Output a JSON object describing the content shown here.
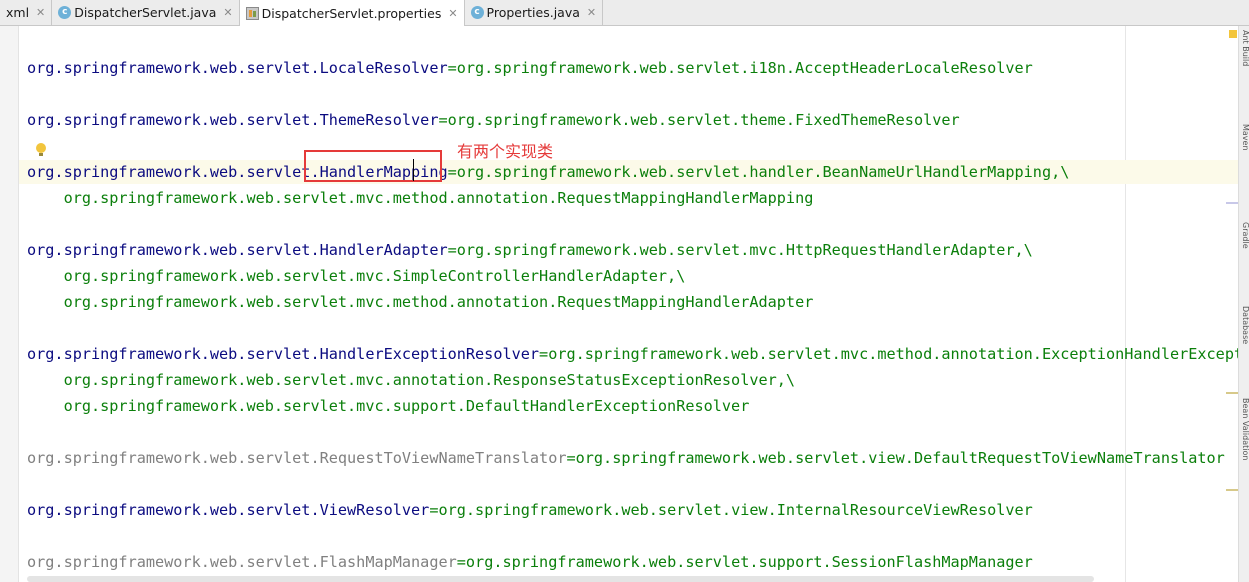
{
  "tabs": [
    {
      "label": "xml",
      "icon": "none"
    },
    {
      "label": "DispatcherServlet.java",
      "icon": "java-class-icon"
    },
    {
      "label": "DispatcherServlet.properties",
      "icon": "properties-file-icon",
      "active": true
    },
    {
      "label": "Properties.java",
      "icon": "java-class-icon"
    }
  ],
  "annotation": "有两个实现类",
  "sidebar_labels": [
    "Ant Build",
    "Maven",
    "Gradle",
    "Database",
    "Bean Validation"
  ],
  "colors": {
    "key": "#0b0b80",
    "value": "#0b7f0b",
    "annotation": "#e53a3a",
    "dim": "#808080"
  },
  "lines": {
    "l1_key": "org.springframework.web.servlet.LocaleResolver",
    "l1_val": "=org.springframework.web.servlet.i18n.AcceptHeaderLocaleResolver",
    "l2_key": "org.springframework.web.servlet.ThemeResolver",
    "l2_val": "=org.springframework.web.servlet.theme.FixedThemeResolver",
    "l3_key": "org.springframework.web.servlet.HandlerMapping",
    "l3_val": "=org.springframework.web.servlet.handler.BeanNameUrlHandlerMapping,\\",
    "l4_val": "    org.springframework.web.servlet.mvc.method.annotation.RequestMappingHandlerMapping",
    "l5_key": "org.springframework.web.servlet.HandlerAdapter",
    "l5_val": "=org.springframework.web.servlet.mvc.HttpRequestHandlerAdapter,\\",
    "l6_val": "    org.springframework.web.servlet.mvc.SimpleControllerHandlerAdapter,\\",
    "l7_val": "    org.springframework.web.servlet.mvc.method.annotation.RequestMappingHandlerAdapter",
    "l8_key": "org.springframework.web.servlet.HandlerExceptionResolver",
    "l8_val": "=org.springframework.web.servlet.mvc.method.annotation.ExceptionHandlerExceptio",
    "l9_val": "    org.springframework.web.servlet.mvc.annotation.ResponseStatusExceptionResolver,\\",
    "l10_val": "    org.springframework.web.servlet.mvc.support.DefaultHandlerExceptionResolver",
    "l11_key": "org.springframework.web.servlet.RequestToViewNameTranslator",
    "l11_val": "=org.springframework.web.servlet.view.DefaultRequestToViewNameTranslator",
    "l12_key": "org.springframework.web.servlet.ViewResolver",
    "l12_val": "=org.springframework.web.servlet.view.InternalResourceViewResolver",
    "l13_key": "org.springframework.web.servlet.FlashMapManager",
    "l13_val": "=org.springframework.web.servlet.support.SessionFlashMapManager"
  }
}
